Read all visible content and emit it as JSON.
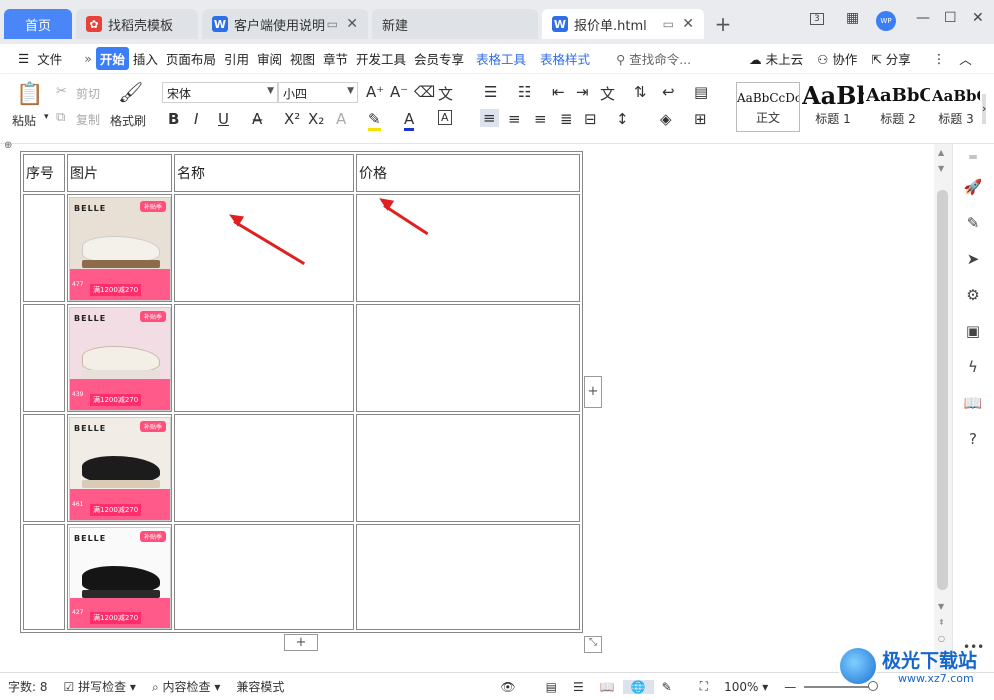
{
  "tabs": [
    {
      "label": "首页"
    },
    {
      "label": "找稻壳模板"
    },
    {
      "label": "客户端使用说明"
    },
    {
      "label": "新建"
    },
    {
      "label": "报价单.html"
    }
  ],
  "window_controls": {
    "badge": "3",
    "avatar": "WP"
  },
  "menu": {
    "file": "文件",
    "more": "»",
    "items": [
      "开始",
      "插入",
      "页面布局",
      "引用",
      "审阅",
      "视图",
      "章节",
      "开发工具",
      "会员专享"
    ],
    "context_items": [
      "表格工具",
      "表格样式"
    ],
    "search_placeholder": "查找命令...",
    "cloud": "未上云",
    "collab": "协作",
    "share": "分享"
  },
  "ribbon": {
    "paste": "粘贴",
    "cut": "剪切",
    "copy": "复制",
    "format_painter": "格式刷",
    "font_name": "宋体",
    "font_size": "小四",
    "styles": [
      {
        "preview": "AaBbCcDc",
        "label": "正文"
      },
      {
        "preview": "AaBb",
        "label": "标题 1"
      },
      {
        "preview": "AaBbC",
        "label": "标题 2"
      },
      {
        "preview": "AaBbC",
        "label": "标题 3"
      }
    ]
  },
  "table": {
    "headers": [
      "序号",
      "图片",
      "名称",
      "价格"
    ],
    "rows": [
      {
        "brand": "BELLE",
        "badge": "补贴季",
        "price": "477",
        "promo": "满1200减270"
      },
      {
        "brand": "BELLE",
        "badge": "补贴季",
        "price": "439",
        "promo": "满1200减270"
      },
      {
        "brand": "BELLE",
        "badge": "补贴季",
        "price": "461",
        "promo": "满1200减270"
      },
      {
        "brand": "BELLE",
        "badge": "补贴季",
        "price": "427",
        "promo": "满1200减270"
      }
    ]
  },
  "status": {
    "word_count": "字数: 8",
    "spell_check": "拼写检查",
    "content_check": "内容检查",
    "compat_mode": "兼容模式",
    "zoom": "100%"
  },
  "watermark": {
    "title": "极光下载站",
    "url": "www.xz7.com"
  },
  "colors": {
    "accent": "#3c7ef7",
    "arrow": "#e02020",
    "promo_pink": "#ff5a8a"
  }
}
